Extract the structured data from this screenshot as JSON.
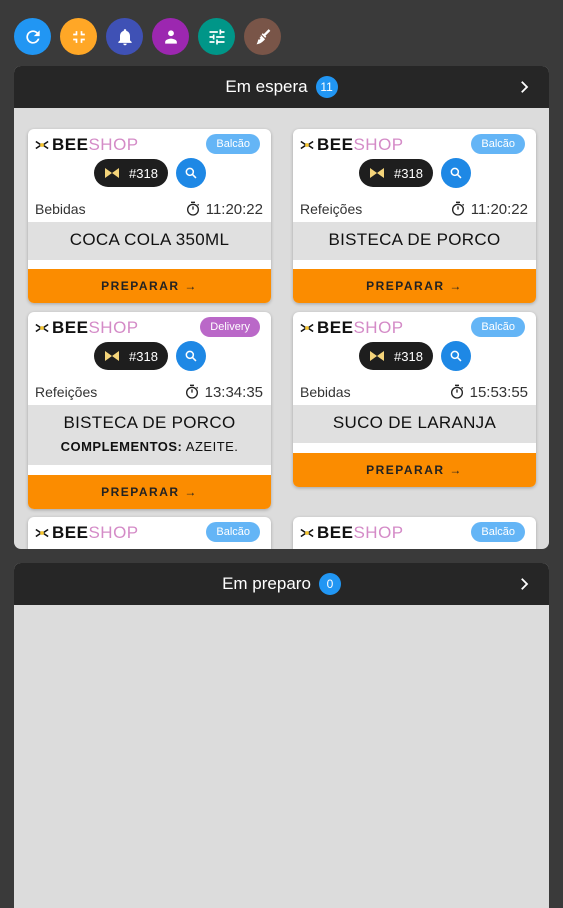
{
  "toolbar": {
    "buttons": [
      {
        "name": "refresh-button",
        "icon": "refresh-icon",
        "color": "#2196f3"
      },
      {
        "name": "fullscreen-exit-button",
        "icon": "fullscreen-exit-icon",
        "color": "#ffa726"
      },
      {
        "name": "notifications-button",
        "icon": "bell-icon",
        "color": "#3f51b5"
      },
      {
        "name": "user-button",
        "icon": "user-badge-icon",
        "color": "#9c27b0"
      },
      {
        "name": "filters-button",
        "icon": "tune-icon",
        "color": "#009688"
      },
      {
        "name": "clean-button",
        "icon": "broom-icon",
        "color": "#795548"
      }
    ]
  },
  "waiting": {
    "title": "Em espera",
    "count": "11"
  },
  "preparing": {
    "title": "Em preparo",
    "count": "0"
  },
  "brand": {
    "bee": "BEE",
    "shop": "SHOP"
  },
  "colors": {
    "balcao": "#64b5f6",
    "delivery": "#ba68c8",
    "prepare": "#fb8c00"
  },
  "cards": [
    {
      "tag": "Balcão",
      "order": "#318",
      "category": "Bebidas",
      "time": "11:20:22",
      "product": "COCA COLA 350ML",
      "complement_label": "",
      "complement_value": "",
      "prepare": "PREPARAR →"
    },
    {
      "tag": "Balcão",
      "order": "#318",
      "category": "Refeições",
      "time": "11:20:22",
      "product": "BISTECA DE PORCO",
      "complement_label": "",
      "complement_value": "",
      "prepare": "PREPARAR →"
    },
    {
      "tag": "Delivery",
      "order": "#318",
      "category": "Refeições",
      "time": "13:34:35",
      "product": "BISTECA DE PORCO",
      "complement_label": "COMPLEMENTOS:",
      "complement_value": "AZEITE.",
      "prepare": "PREPARAR →"
    },
    {
      "tag": "Balcão",
      "order": "#318",
      "category": "Bebidas",
      "time": "15:53:55",
      "product": "SUCO DE LARANJA",
      "complement_label": "",
      "complement_value": "",
      "prepare": "PREPARAR →"
    },
    {
      "tag": "Balcão"
    },
    {
      "tag": "Balcão"
    }
  ]
}
